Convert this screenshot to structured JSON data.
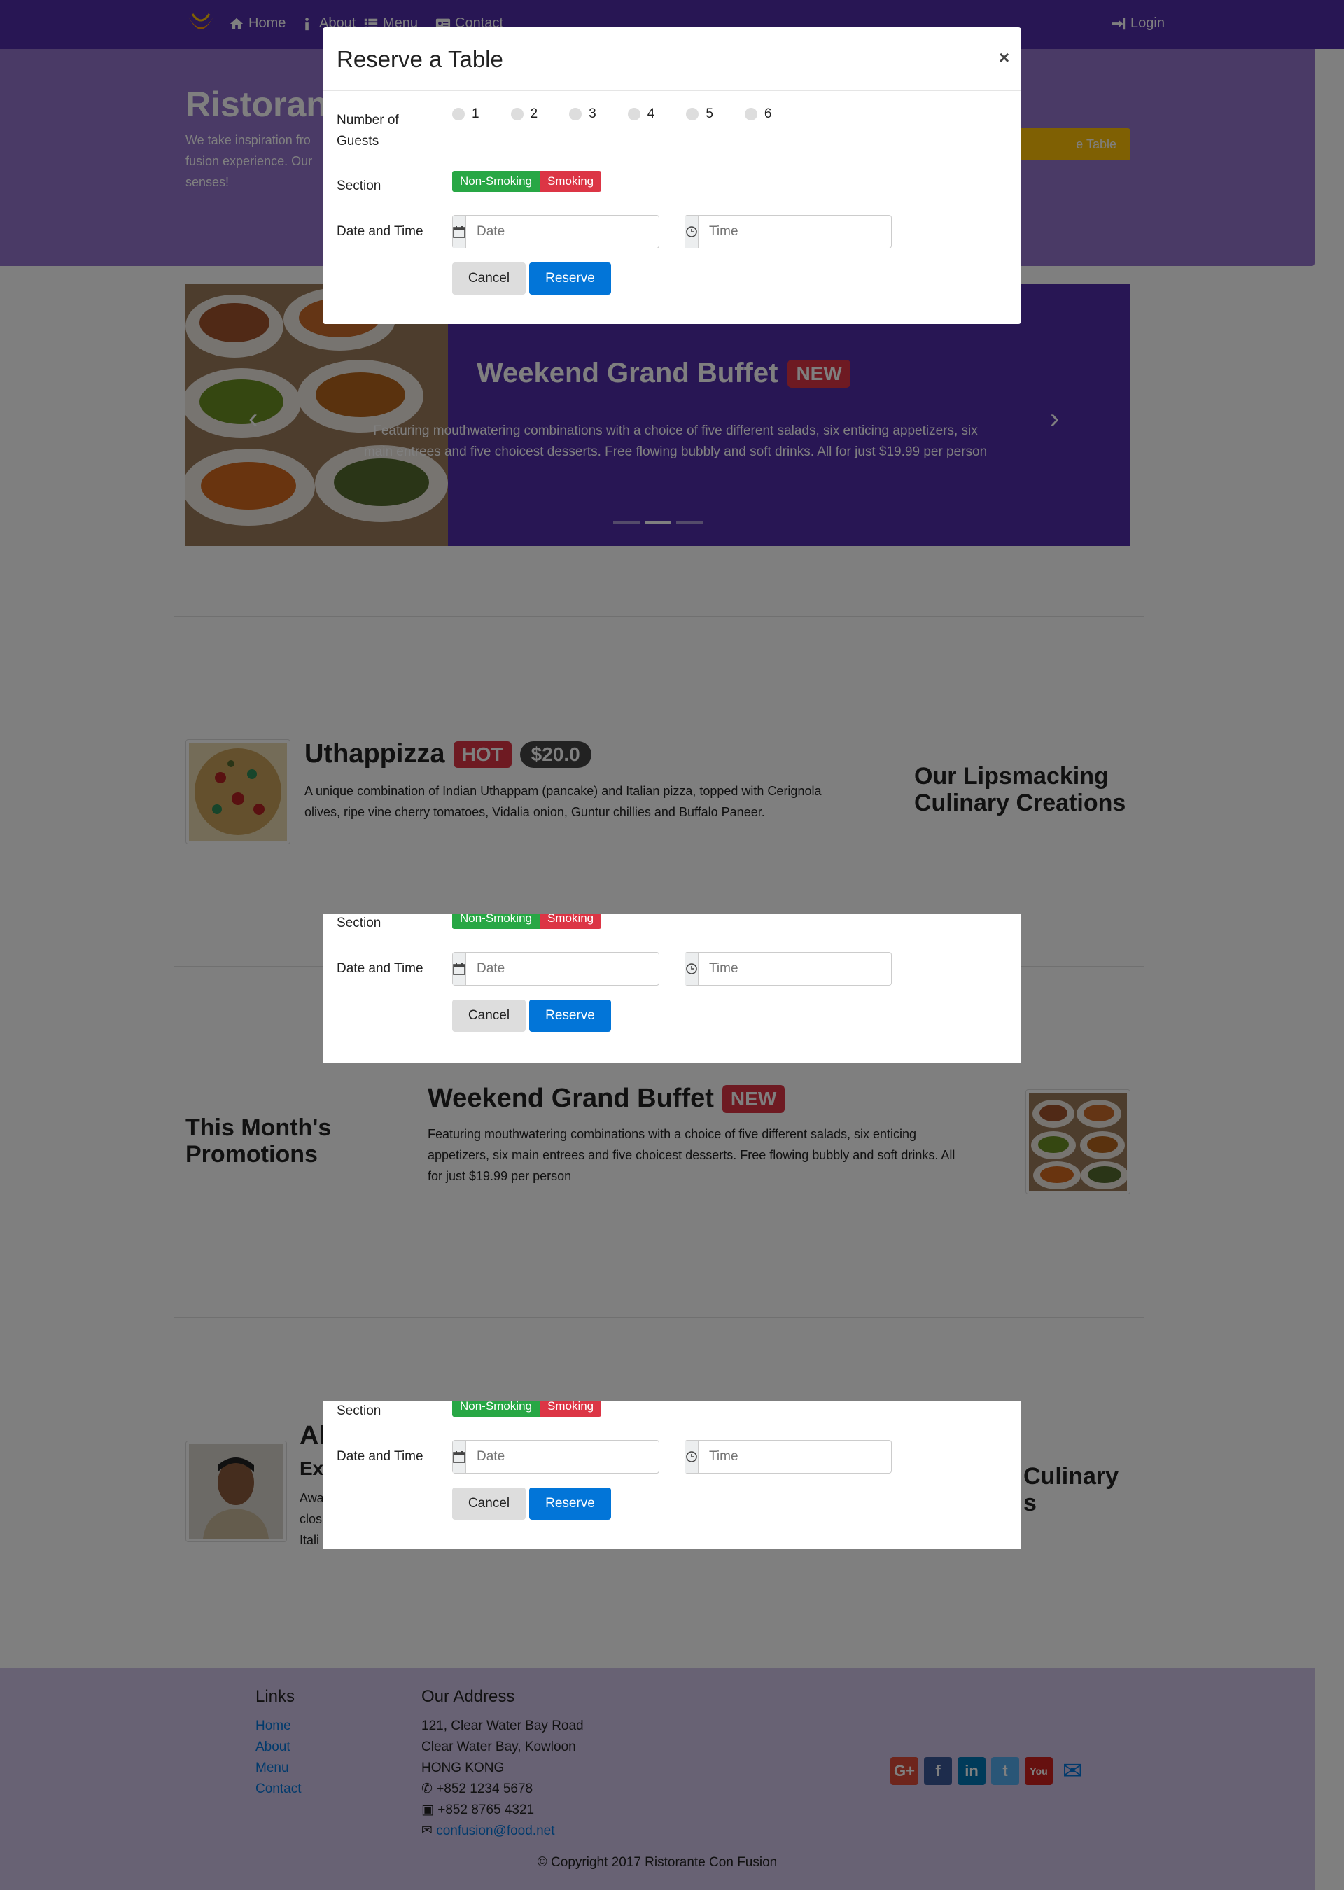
{
  "navbar": {
    "items": [
      {
        "label": "Home",
        "icon": "home-icon"
      },
      {
        "label": "About",
        "icon": "info-icon"
      },
      {
        "label": "Menu",
        "icon": "list-icon"
      },
      {
        "label": "Contact",
        "icon": "address-card-icon"
      }
    ],
    "login": "Login"
  },
  "jumbotron": {
    "title": "Ristorante",
    "text": "We take inspiration fr… fusion experience. Our… senses!",
    "text_lines": [
      "We take inspiration fro",
      "fusion experience. Our",
      "senses!"
    ],
    "button": "e Table"
  },
  "carousel": {
    "title": "Weekend Grand Buffet",
    "badge": "NEW",
    "caption": "Featuring mouthwatering combinations with a choice of five different salads, six enticing appetizers, six main entrees and five choicest desserts. Free flowing bubbly and soft drinks. All for just $19.99 per person",
    "caption_lines": [
      "Featuring mouthwatering combinations with a choice of five different salads, six enticing appetizers, six",
      "main entrees and five choicest desserts. Free flowing bubbly and soft drinks. All for just $19.99 per person"
    ],
    "active_indicator": 2,
    "indicator_count": 3
  },
  "dish": {
    "name": "Uthappizza",
    "badge": "HOT",
    "price": "$20.0",
    "description_lines": [
      "A unique combination of Indian Uthappam (pancake) and Italian pizza, topped with Cerignola",
      "olives, ripe vine cherry tomatoes, Vidalia onion, Guntur chillies and Buffalo Paneer."
    ],
    "side_heading_lines": [
      "Our Lipsmacking",
      "Culinary Creations"
    ]
  },
  "promotion": {
    "side_heading_lines": [
      "This Month's",
      "Promotions"
    ],
    "name": "Weekend Grand Buffet",
    "badge": "NEW",
    "description_lines": [
      "Featuring mouthwatering combinations with a choice of five different salads, six enticing",
      "appetizers, six main entrees and five choicest desserts. Free flowing bubbly and soft drinks. All",
      "for just $19.99 per person"
    ]
  },
  "leader": {
    "name_partial": "Al",
    "title_partial": "Ex",
    "text_partial": [
      "Awa",
      "clos",
      "Itali"
    ],
    "side_heading_partial": [
      "Culinary",
      "s"
    ]
  },
  "footer": {
    "links_heading": "Links",
    "links": [
      "Home",
      "About",
      "Menu",
      "Contact"
    ],
    "address_heading": "Our Address",
    "address_lines": [
      "121, Clear Water Bay Road",
      "Clear Water Bay, Kowloon",
      "HONG KONG"
    ],
    "phone": "+852 1234 5678",
    "fax": "+852 8765 4321",
    "email": "confusion@food.net",
    "social": [
      {
        "icon": "google-plus-icon",
        "glyph": "G+",
        "color": "#dd4b39"
      },
      {
        "icon": "facebook-icon",
        "glyph": "f",
        "color": "#3b5998"
      },
      {
        "icon": "linkedin-icon",
        "glyph": "in",
        "color": "#0077b5"
      },
      {
        "icon": "twitter-icon",
        "glyph": "t",
        "color": "#55acee"
      },
      {
        "icon": "youtube-icon",
        "glyph": "You",
        "color": "#cd201f"
      },
      {
        "icon": "mail-icon",
        "glyph": "✉",
        "color": "#0275d8"
      }
    ],
    "copyright": "© Copyright 2017 Ristorante Con Fusion"
  },
  "modal": {
    "title": "Reserve a Table",
    "close": "×",
    "guests_label_lines": [
      "Number of",
      "Guests"
    ],
    "guest_options": [
      "1",
      "2",
      "3",
      "4",
      "5",
      "6"
    ],
    "section_label": "Section",
    "section_options": [
      "Non-Smoking",
      "Smoking"
    ],
    "datetime_label": "Date and Time",
    "date_placeholder": "Date",
    "time_placeholder": "Time",
    "cancel": "Cancel",
    "reserve": "Reserve"
  }
}
